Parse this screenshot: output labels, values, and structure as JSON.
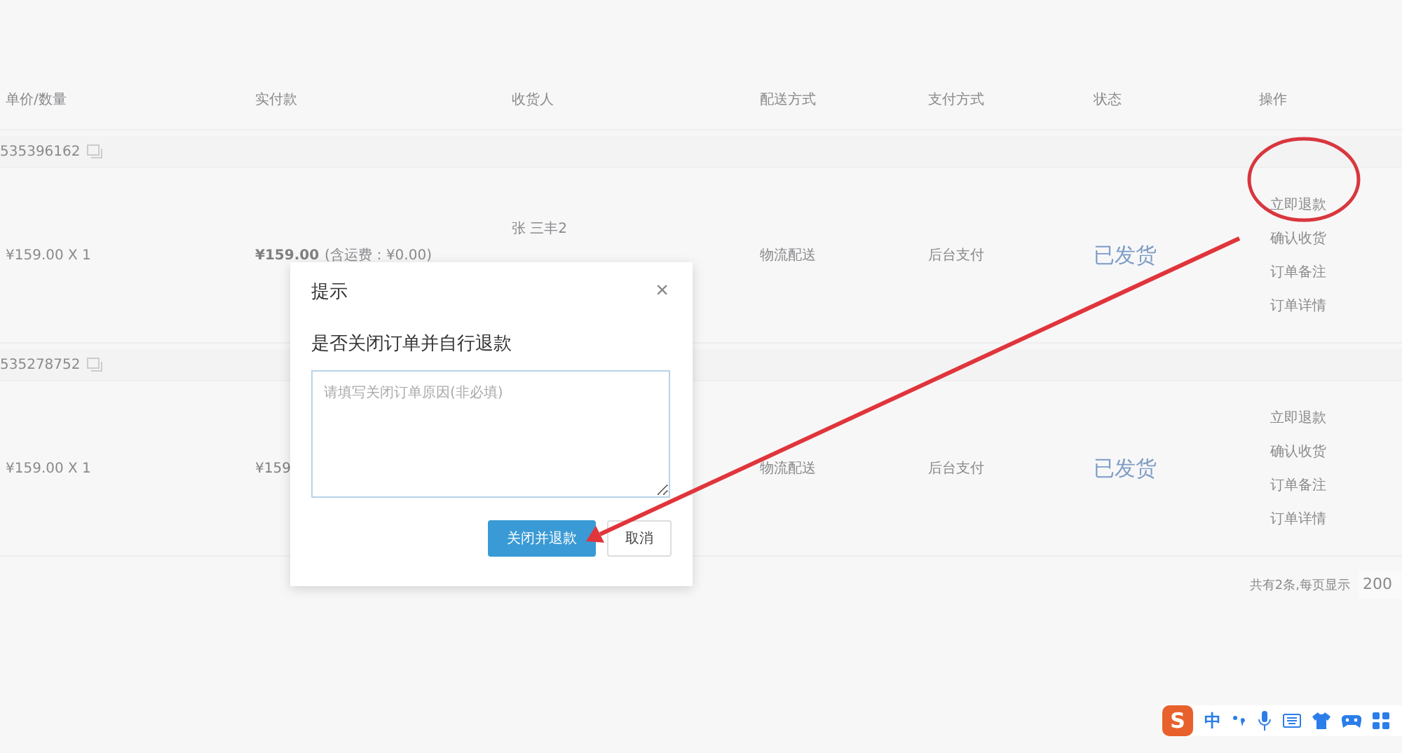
{
  "table": {
    "columns": [
      "单价/数量",
      "实付款",
      "收货人",
      "配送方式",
      "支付方式",
      "状态",
      "操作"
    ],
    "orders": [
      {
        "order_no": "535396162",
        "price_qty": "¥159.00 X 1",
        "paid": "¥159.00",
        "bold": true,
        "paid_note": "(含运费：¥0.00)",
        "receiver": "张 三丰2",
        "delivery": "物流配送",
        "payment": "后台支付",
        "status": "已发货",
        "actions": [
          "立即退款",
          "确认收货",
          "订单备注",
          "订单详情"
        ]
      },
      {
        "order_no": "535278752",
        "price_qty": "¥159.00 X 1",
        "paid": "¥159",
        "bold": false,
        "delivery": "物流配送",
        "payment": "后台支付",
        "status": "已发货",
        "actions": [
          "立即退款",
          "确认收货",
          "订单备注",
          "订单详情"
        ]
      }
    ]
  },
  "pagination": {
    "summary": "共有2条,每页显示",
    "page_size": "200"
  },
  "dialog": {
    "title": "提示",
    "close": "×",
    "message": "是否关闭订单并自行退款",
    "placeholder": "请填写关闭订单原因(非必填)",
    "buttons": [
      {
        "label": "关闭并退款",
        "kind": "primary"
      },
      {
        "label": "取消",
        "kind": "default"
      }
    ]
  },
  "ime_toolbar": {
    "logo": "S",
    "mode": "中"
  }
}
